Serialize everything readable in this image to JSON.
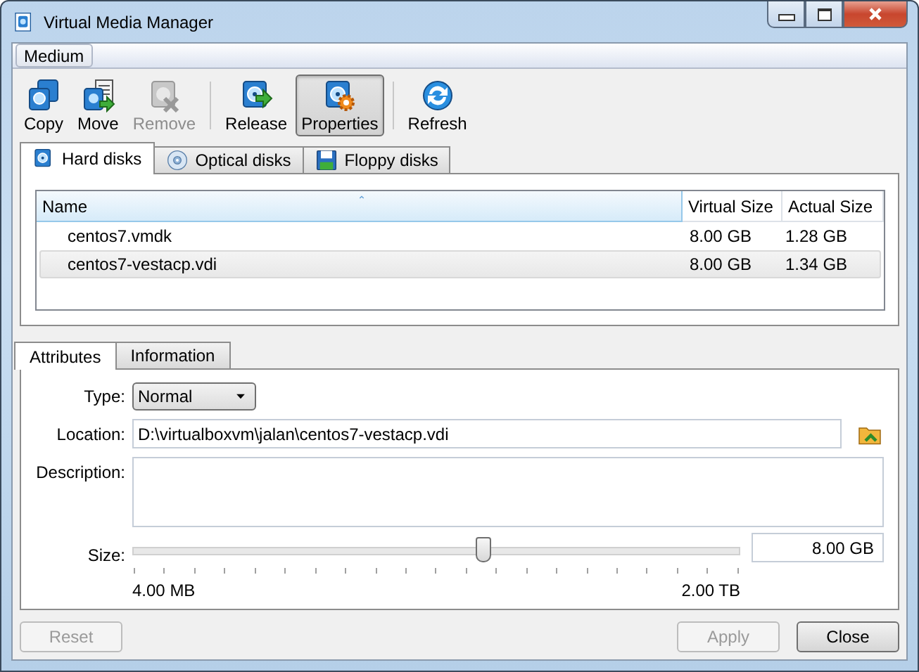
{
  "window": {
    "title": "Virtual Media Manager"
  },
  "menu": [
    {
      "label": "Medium"
    }
  ],
  "toolbar": [
    {
      "label": "Copy",
      "kind": "copy",
      "disabled": false,
      "pressed": false,
      "separator_before": false
    },
    {
      "label": "Move",
      "kind": "move",
      "disabled": false,
      "pressed": false,
      "separator_before": false
    },
    {
      "label": "Remove",
      "kind": "remove",
      "disabled": true,
      "pressed": false,
      "separator_before": false
    },
    {
      "label": "Release",
      "kind": "release",
      "disabled": false,
      "pressed": false,
      "separator_before": true
    },
    {
      "label": "Properties",
      "kind": "properties",
      "disabled": false,
      "pressed": true,
      "separator_before": false
    },
    {
      "label": "Refresh",
      "kind": "refresh",
      "disabled": false,
      "pressed": false,
      "separator_before": true
    }
  ],
  "media_tabs": [
    {
      "label": "Hard disks",
      "kind": "hdd",
      "selected": true
    },
    {
      "label": "Optical disks",
      "kind": "cd",
      "selected": false
    },
    {
      "label": "Floppy disks",
      "kind": "floppy",
      "selected": false
    }
  ],
  "table": {
    "columns": [
      "Name",
      "Virtual Size",
      "Actual Size"
    ],
    "rows": [
      {
        "cells": [
          "centos7.vmdk",
          "8.00 GB",
          "1.28 GB"
        ],
        "selected": false
      },
      {
        "cells": [
          "centos7-vestacp.vdi",
          "8.00 GB",
          "1.34 GB"
        ],
        "selected": true
      }
    ]
  },
  "detail_tabs": [
    {
      "label": "Attributes",
      "selected": true
    },
    {
      "label": "Information",
      "selected": false
    }
  ],
  "attributes": {
    "type_label": "Type:",
    "type_value": "Normal",
    "location_label": "Location:",
    "location_value": "D:\\virtualboxvm\\jalan\\centos7-vestacp.vdi",
    "description_label": "Description:",
    "size_label": "Size:",
    "size": {
      "level": 0.576,
      "value": "8.00 GB",
      "min_label": "4.00 MB",
      "max_label": "2.00 TB"
    }
  },
  "buttons": [
    {
      "label": "Reset",
      "disabled": true
    },
    {
      "label": "Apply",
      "disabled": true
    },
    {
      "label": "Close",
      "disabled": false
    }
  ]
}
